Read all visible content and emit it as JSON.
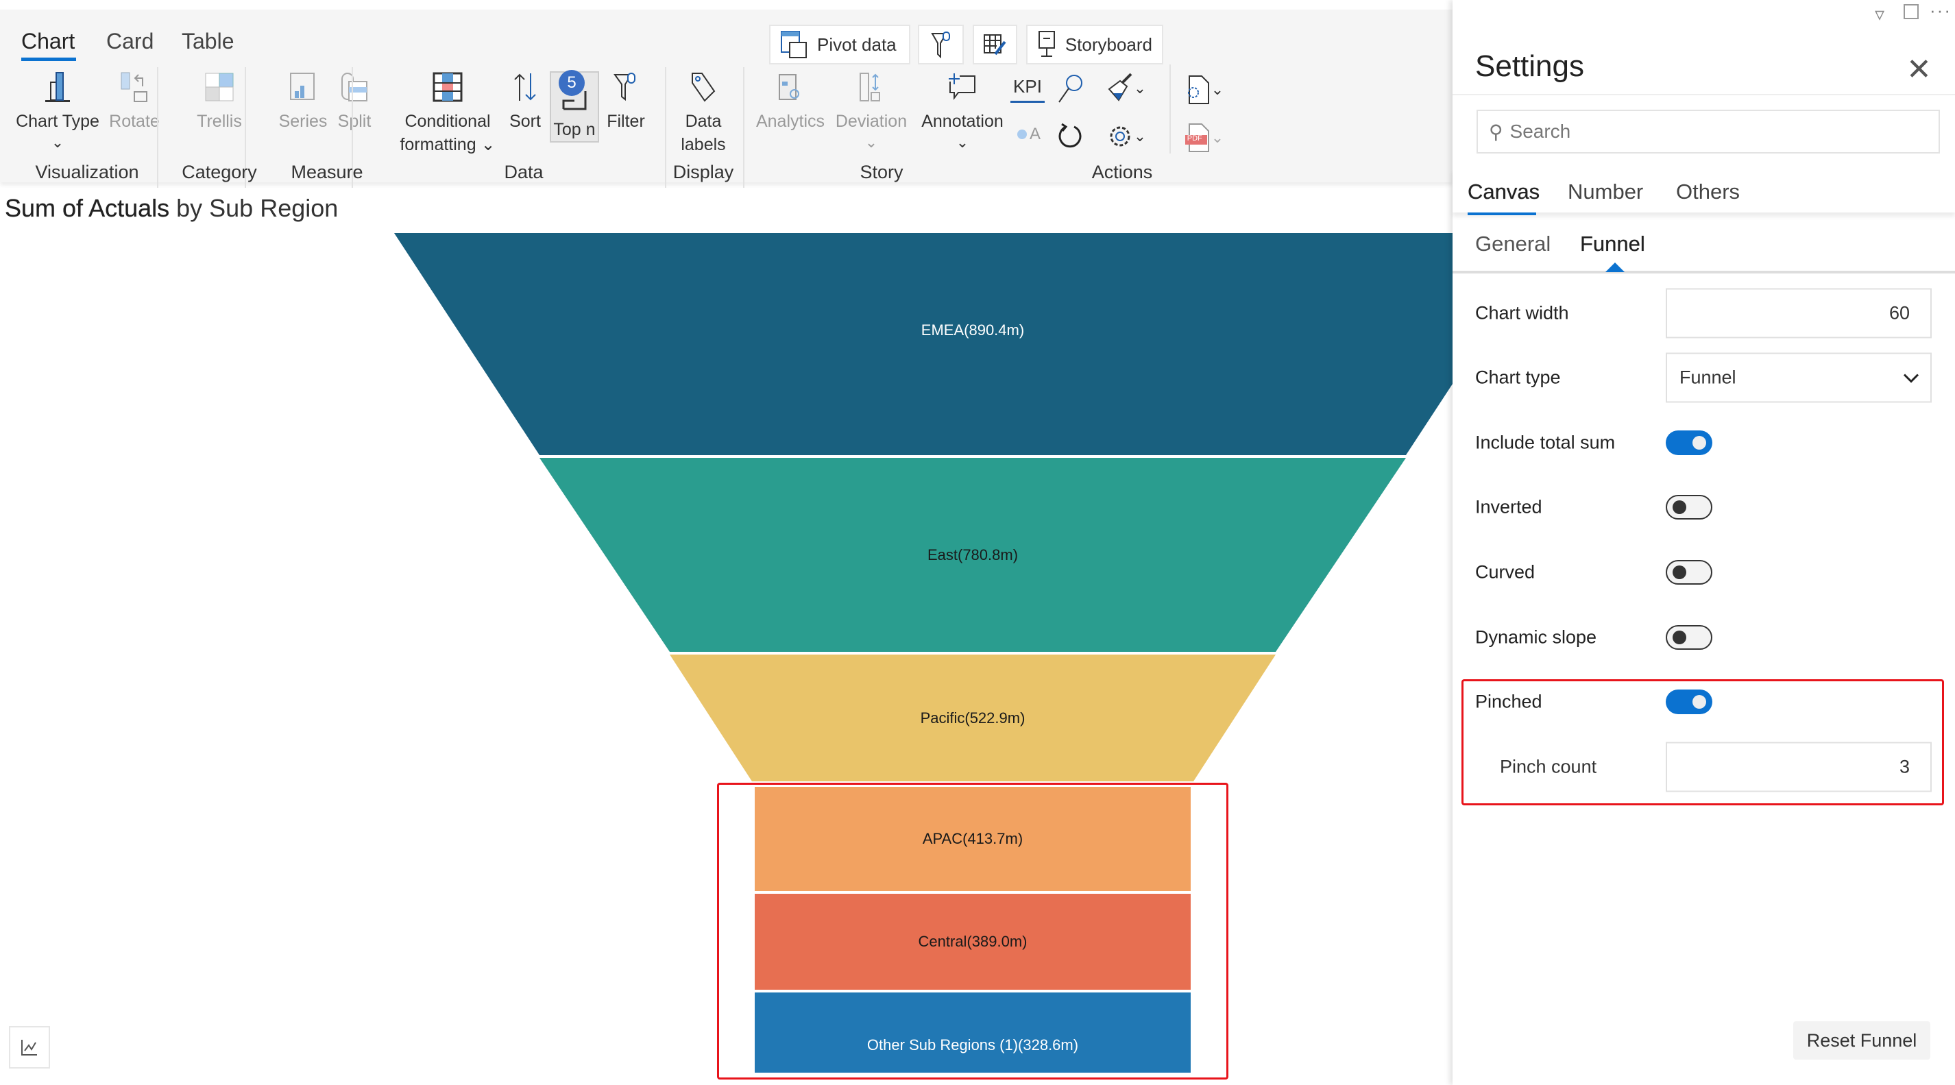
{
  "toolbar": {
    "tabs": [
      "Chart",
      "Card",
      "Table"
    ],
    "active_tab": "Chart",
    "buttons": {
      "chart_type": "Chart Type",
      "rotate": "Rotate",
      "trellis": "Trellis",
      "series": "Series",
      "split": "Split",
      "conditional_1": "Conditional",
      "conditional_2": "formatting",
      "sort": "Sort",
      "top_n": "Top n",
      "top_n_badge": "5",
      "filter": "Filter",
      "data_labels_1": "Data",
      "data_labels_2": "labels",
      "analytics": "Analytics",
      "deviation": "Deviation",
      "annotation": "Annotation",
      "kpi": "KPI",
      "oa": "A",
      "pdf": "PDF"
    },
    "top_buttons": {
      "pivot_data": "Pivot data",
      "storyboard": "Storyboard"
    },
    "groups": {
      "visualization": "Visualization",
      "category": "Category",
      "measure": "Measure",
      "data": "Data",
      "display": "Display",
      "story": "Story",
      "actions": "Actions"
    }
  },
  "chart_title": {
    "measure": "Sum of Actuals",
    "rest": " by Sub Region"
  },
  "chart_data": {
    "type": "funnel",
    "title": "Sum of Actuals by Sub Region",
    "pinched": true,
    "pinch_count": 3,
    "categories": [
      "EMEA",
      "East",
      "Pacific",
      "APAC",
      "Central",
      "Other Sub Regions (1)"
    ],
    "values": [
      890.4,
      780.8,
      522.9,
      413.7,
      389.0,
      328.6
    ],
    "labels": [
      "EMEA(890.4m)",
      "East(780.8m)",
      "Pacific(522.9m)",
      "APAC(413.7m)",
      "Central(389.0m)",
      "Other Sub Regions (1)(328.6m)"
    ],
    "colors": [
      "#19607f",
      "#2a9d8f",
      "#e9c46a",
      "#f2a261",
      "#e76f51",
      "#2178b4"
    ],
    "label_colors": [
      "#ffffff",
      "#1a1a1a",
      "#1a1a1a",
      "#1a1a1a",
      "#1a1a1a",
      "#ffffff"
    ]
  },
  "settings": {
    "title": "Settings",
    "search_placeholder": "Search",
    "tabs": [
      "Canvas",
      "Number",
      "Others"
    ],
    "subtabs": [
      "General",
      "Funnel"
    ],
    "rows": {
      "chart_width_label": "Chart width",
      "chart_width_value": "60",
      "chart_type_label": "Chart type",
      "chart_type_value": "Funnel",
      "include_total_label": "Include total sum",
      "include_total": true,
      "inverted_label": "Inverted",
      "inverted": false,
      "curved_label": "Curved",
      "curved": false,
      "dynamic_slope_label": "Dynamic slope",
      "dynamic_slope": false,
      "pinched_label": "Pinched",
      "pinched": true,
      "pinch_count_label": "Pinch count",
      "pinch_count_value": "3"
    },
    "reset_label": "Reset Funnel"
  },
  "accent_color": "#0b72d0"
}
